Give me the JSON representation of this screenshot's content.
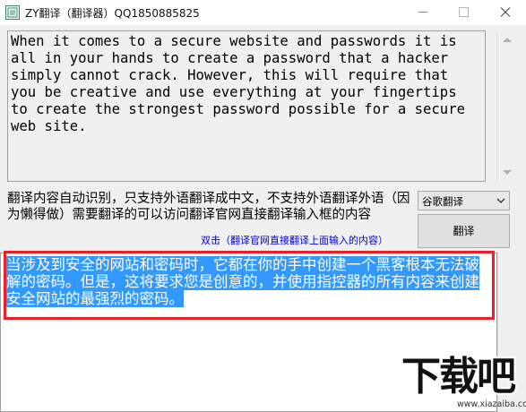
{
  "window": {
    "title": "ZY翻译（翻译器）QQ1850885825"
  },
  "source": {
    "text": "When it comes to a secure website and passwords it is\nall in your hands to create a password that a hacker\nsimply cannot crack. However, this will require that\nyou be creative and use everything at your fingertips\nto create the strongest password possible for a secure\nweb site."
  },
  "info": {
    "description": "翻译内容自动识别，只支持外语翻译成中文，不支持外语翻译外语（因为懒得做）需要翻译的可以访问翻译官网直接翻译输入框的内容",
    "link": "双击（翻译官网直接翻译上面输入的内容）"
  },
  "controls": {
    "engine_selected": "谷歌翻译",
    "translate_label": "翻译"
  },
  "output": {
    "text": "当涉及到安全的网站和密码时，它都在你的手中创建一个黑客根本无法破解的密码。但是，这将要求您是创意的，并使用指控器的所有内容来创建安全网站的最强烈的密码。"
  },
  "watermark": {
    "logo_text": "下载吧",
    "site": "www.xiazaiba.com"
  },
  "colors": {
    "selection": "#3399ff",
    "highlight_border": "#e8202a",
    "link": "#0000d0"
  }
}
